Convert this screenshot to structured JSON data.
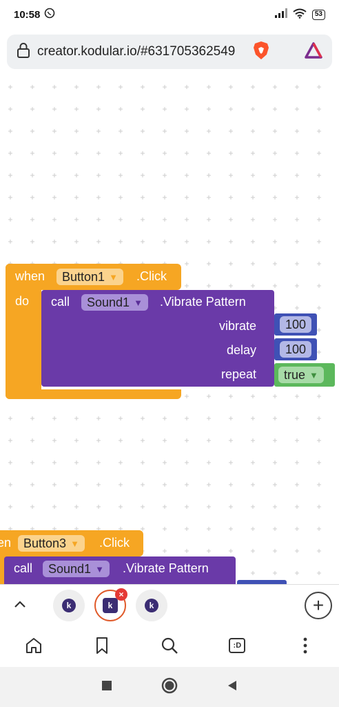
{
  "status": {
    "time": "10:58",
    "battery": "53"
  },
  "browser": {
    "url": "creator.kodular.io/#631705362549"
  },
  "blocks": {
    "event1": {
      "when": "when",
      "component": "Button1",
      "event": ".Click",
      "do": "do"
    },
    "call1": {
      "call": "call",
      "component": "Sound1",
      "method": ".Vibrate Pattern",
      "params": [
        {
          "name": "vibrate",
          "value": "100"
        },
        {
          "name": "delay",
          "value": "100"
        },
        {
          "name": "repeat",
          "value": "true"
        }
      ]
    },
    "event2": {
      "when": "en",
      "component": "Button3",
      "event": ".Click"
    },
    "call2": {
      "call": "call",
      "component": "Sound1",
      "method": ".Vibrate Pattern"
    }
  },
  "tabs": {
    "active_badge": "×",
    "plus": "+",
    "tab_letter": "k"
  },
  "bottomnav": {
    "tabcount": ":D"
  },
  "colors": {
    "event": "#f6a623",
    "procedure": "#6a3aa8",
    "number": "#3f51b5",
    "boolean": "#5cb85c"
  }
}
